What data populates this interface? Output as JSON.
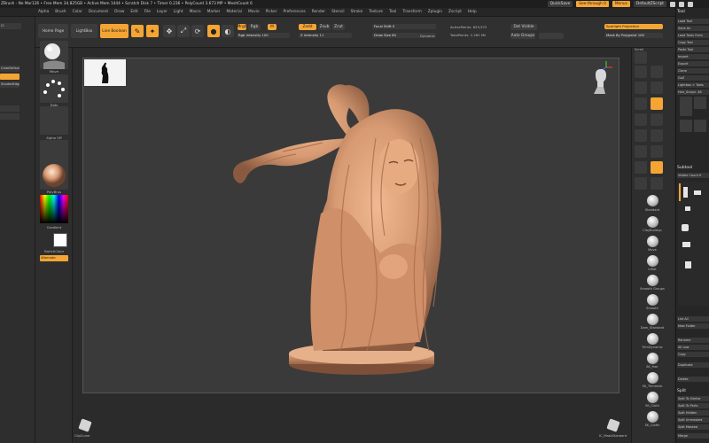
{
  "titlebar": {
    "title": "ZBrush - Ne Mar126 • Free Mem 34.825GB • Active Mem 1444 • Scratch Disk 7 • Timer 0.236 • PolyCount 3.673 MP • MeshCount 6",
    "quicksave": "QuickSave",
    "see_through": "See-through 0",
    "menus": "Menus",
    "default_script": "DefaultZScript"
  },
  "menubar": {
    "items": [
      "Alpha",
      "Brush",
      "Color",
      "Document",
      "Draw",
      "Edit",
      "File",
      "Layer",
      "Light",
      "Macro",
      "Marker",
      "Material",
      "Movie",
      "Picker",
      "Preferences",
      "Render",
      "Stencil",
      "Stroke",
      "Texture",
      "Tool",
      "Transform",
      "Zplugin",
      "Zscript",
      "Help"
    ]
  },
  "toolbar": {
    "home_page": "Home Page",
    "lightbox": "LightBox",
    "live_boolean": "Live Boolean",
    "edit": "Edit",
    "draw": "Draw",
    "move": "Move",
    "scale": "Scale",
    "rotate": "Rotate",
    "mrgb": "Mrgb",
    "rgb": "Rgb",
    "m": "M",
    "zadd": "Zadd",
    "zsub": "Zsub",
    "zcut": "Zcut",
    "rgb_intensity": "Rgb Intensity 100",
    "z_intensity": "Z Intensity 11",
    "focal_shift": "Focal Shift 0",
    "draw_size": "Draw Size 64",
    "dynamic": "Dynamic",
    "active_points": "ActivePoints: 629,572",
    "total_points": "TotalPoints: 2.282 Mil",
    "dots": [
      "Dot Visible",
      "Auto Groups"
    ],
    "spotlight": "Spotlight Projection",
    "maskby": "Mask By Polypaint 100"
  },
  "leftpanel": {
    "items": [
      "Cl",
      "",
      "ColorDefault",
      "",
      "ShadedEdges",
      "",
      ""
    ]
  },
  "lefttools": {
    "labels": [
      "Move",
      "Dots",
      "Alpha Off",
      "Texture Off",
      "PolyBrus",
      "Gradient",
      "SwitchColor",
      "Alternate"
    ]
  },
  "shelf": {
    "icons": [
      "Scroll",
      "Zoom",
      "Actual",
      "AAHalf",
      "Dynamic",
      "Persp",
      "Floor",
      "Local",
      "Frame",
      "Move",
      "Scale",
      "Rotate",
      "PolyF",
      "Transp",
      "Ghost",
      "Solo",
      "Xpose"
    ]
  },
  "brushes": {
    "labels": [
      "Standard",
      "ClayBuildup",
      "Move",
      "Inflat",
      "Smooth Groups",
      "Smooth",
      "Dam_Standard",
      "TrimDynamic",
      "SK_Hair",
      "SK_Trimmish",
      "SK_Cloth",
      "SK_Clothi"
    ]
  },
  "toolpanel": {
    "header": "Tool",
    "items": [
      "Load Tool",
      "Save As",
      "Load Tools From",
      "Copy Tool",
      "Paste Tool",
      "Import",
      "Export",
      "Clone",
      "Make PolyMesh3D",
      "GoZ",
      "All",
      "Visible",
      "R",
      "Lightbox > Tools",
      "Hair_Sculpt. 48"
    ],
    "thumbs": [
      "Hair_Sculpt",
      "PolyMesh3D",
      "SimpleBrush",
      "Cylinder3D"
    ],
    "subtool_header": "Subtool",
    "visible": "Visible Count 9",
    "bottom_items": [
      "List All",
      "New Folder",
      "Rename",
      "All Low",
      "Copy",
      "Duplicate",
      "Delete",
      "Split",
      "Split To Similar",
      "Split To Parts",
      "Split Hidden",
      "Split Unmasked",
      "Split Masked",
      "Merge"
    ]
  },
  "bottombar": {
    "left_label": "ClipCurve",
    "right_label": "IC_MaskStandard"
  },
  "colors": {
    "accent": "#f4a534",
    "sculpt": "#d79a72",
    "canvas_bg": "#3a3a3a"
  }
}
